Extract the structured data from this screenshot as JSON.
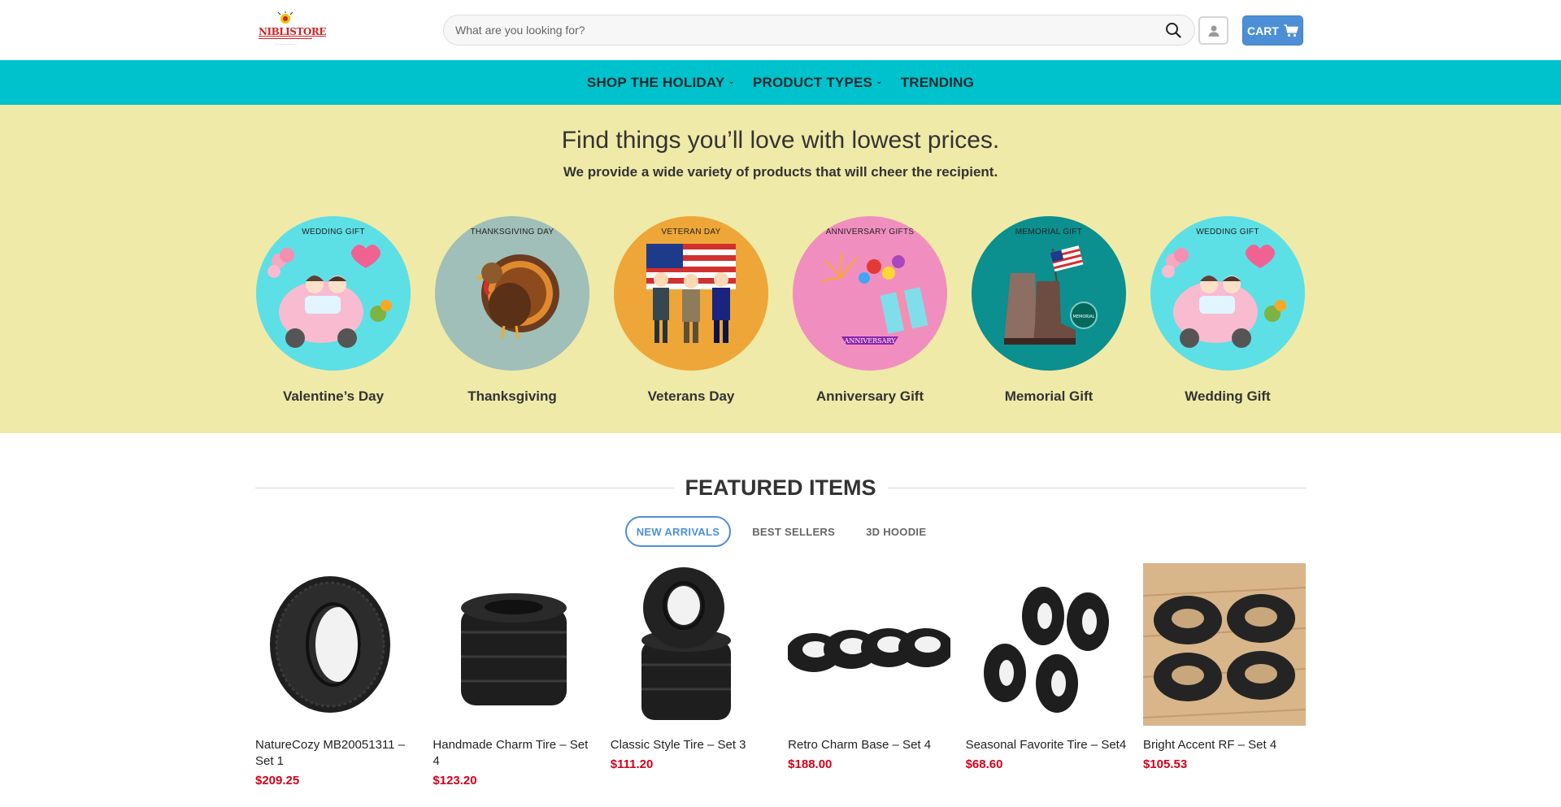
{
  "header": {
    "logo_text": "NIBLISTORE",
    "search_placeholder": "What are you looking for?",
    "cart_label": "CART"
  },
  "nav": {
    "items": [
      {
        "label": "SHOP THE HOLIDAY",
        "dropdown": true
      },
      {
        "label": "PRODUCT TYPES",
        "dropdown": true
      },
      {
        "label": "TRENDING",
        "dropdown": false
      }
    ]
  },
  "hero": {
    "title": "Find things you’ll love with lowest prices.",
    "subtitle": "We provide a wide variety of products that will cheer the recipient.",
    "categories": [
      {
        "label": "Valentine’s Day",
        "badge": "WEDDING GIFT",
        "color": "#5ddfe6"
      },
      {
        "label": "Thanksgiving",
        "badge": "THANKSGIVING DAY",
        "color": "#9fbfb8"
      },
      {
        "label": "Veterans Day",
        "badge": "VETERAN DAY",
        "color": "#eda637"
      },
      {
        "label": "Anniversary Gift",
        "badge": "ANNIVERSARY GIFTS",
        "color": "#f08fbf"
      },
      {
        "label": "Memorial Gift",
        "badge": "MEMORIAL GIFT",
        "color": "#0b8f8f"
      },
      {
        "label": "Wedding Gift",
        "badge": "WEDDING GIFT",
        "color": "#5ddfe6"
      }
    ]
  },
  "featured": {
    "title": "FEATURED ITEMS",
    "tabs": [
      "NEW ARRIVALS",
      "BEST SELLERS",
      "3D HOODIE"
    ],
    "products": [
      {
        "name": "NatureCozy MB20051311 – Set 1",
        "price": "$209.25"
      },
      {
        "name": "Handmade Charm Tire – Set 4",
        "price": "$123.20"
      },
      {
        "name": "Classic Style Tire – Set 3",
        "price": "$111.20"
      },
      {
        "name": "Retro Charm Base – Set 4",
        "price": "$188.00"
      },
      {
        "name": "Seasonal Favorite Tire – Set4",
        "price": "$68.60"
      },
      {
        "name": "Bright Accent RF – Set 4",
        "price": "$105.53"
      }
    ]
  },
  "colors": {
    "nav_bg": "#00c2cc",
    "hero_bg": "#f0eaa8",
    "accent": "#4d8fd6",
    "price": "#d0021b"
  }
}
